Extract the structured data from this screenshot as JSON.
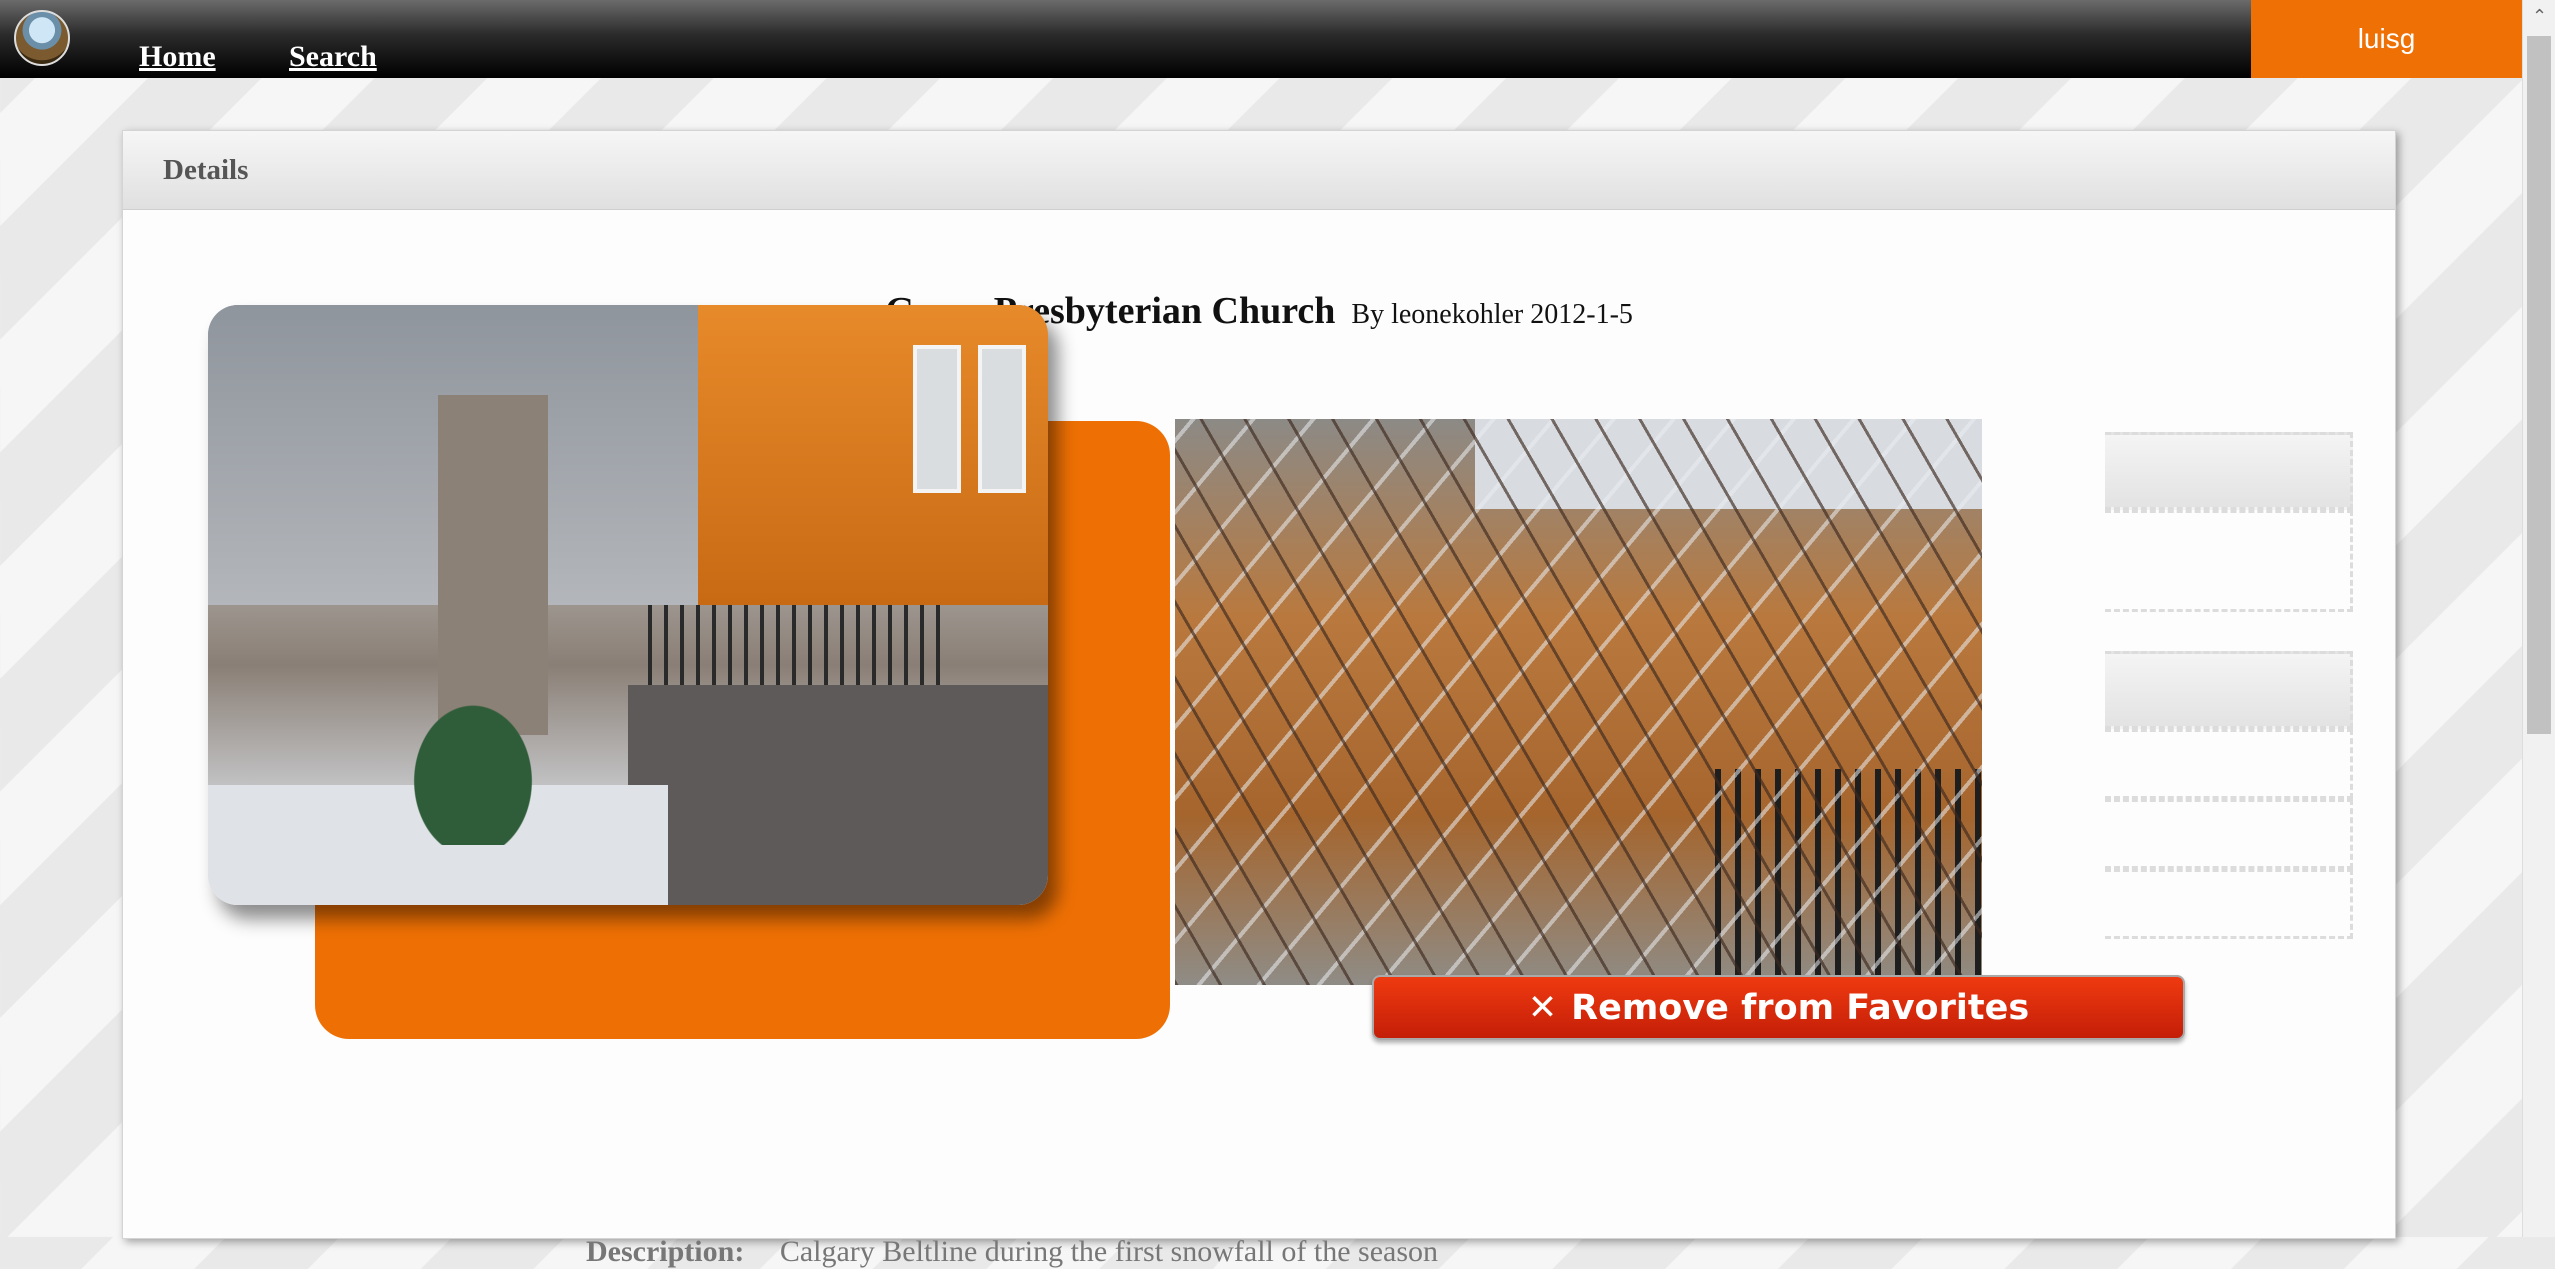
{
  "nav": {
    "home_label": "Home",
    "search_label": "Search",
    "user_label": "luisg"
  },
  "panel": {
    "header": "Details"
  },
  "photo": {
    "title": "Grace Presbyterian Church",
    "byline": "By leonekohler 2012-1-5",
    "description_label": "Description:",
    "description": "Calgary Beltline during the first snowfall of the season"
  },
  "actions": {
    "remove_icon": "✕",
    "remove_label": "Remove from Favorites"
  },
  "icons": {
    "logo": "site-logo",
    "scroll_up": "chevron-up-icon",
    "remove": "close-icon"
  },
  "colors": {
    "accent": "#ef7106",
    "danger": "#d32a0c"
  }
}
